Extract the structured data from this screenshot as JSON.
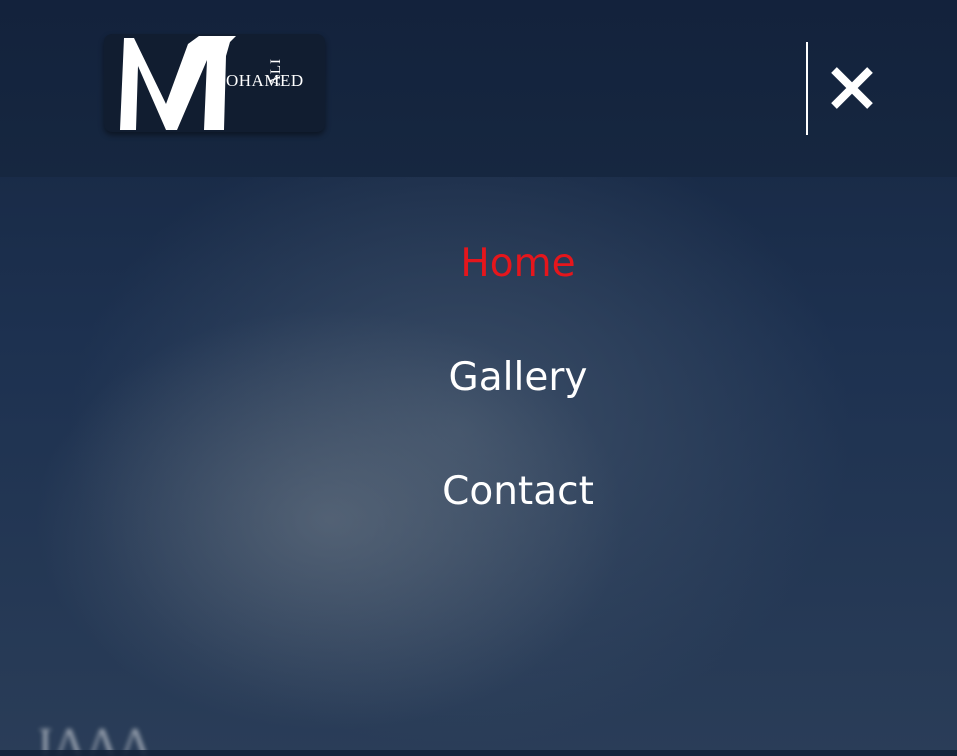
{
  "header": {
    "logo": {
      "initial": "M",
      "ali": "ALI",
      "ohamed": "OHAMED"
    },
    "close_icon": "close-icon"
  },
  "menu": {
    "items": [
      {
        "label": "Home",
        "active": true
      },
      {
        "label": "Gallery",
        "active": false
      },
      {
        "label": "Contact",
        "active": false
      }
    ]
  },
  "colors": {
    "active": "#e5161c",
    "text": "#ffffff",
    "header_bg": "#13223c"
  }
}
